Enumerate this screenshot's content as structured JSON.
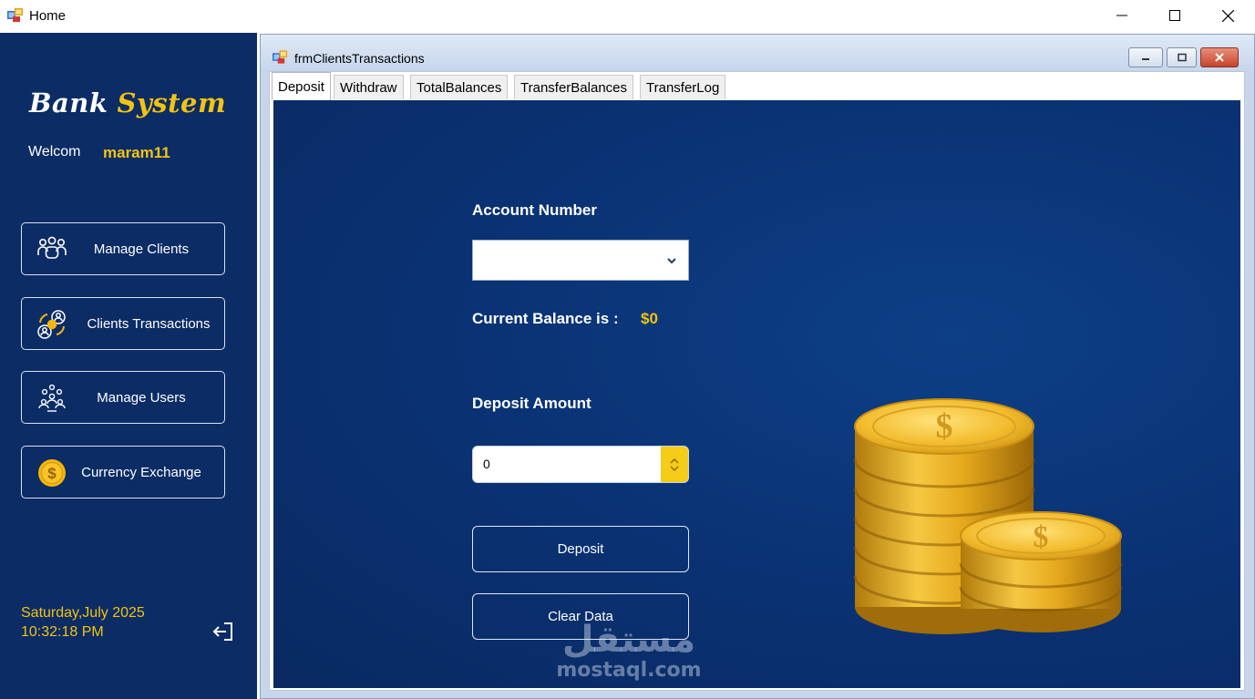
{
  "window": {
    "title": "Home"
  },
  "sidebar": {
    "brand_primary": "Bank",
    "brand_accent": "System",
    "welcome_label": "Welcom",
    "username": "maram11",
    "nav": [
      {
        "label": "Manage Clients",
        "icon": "users-group-icon"
      },
      {
        "label": "Clients Transactions",
        "icon": "money-transfer-icon"
      },
      {
        "label": "Manage Users",
        "icon": "user-network-icon"
      },
      {
        "label": "Currency Exchange",
        "icon": "dollar-coin-icon"
      }
    ],
    "date": "Saturday,July 2025",
    "time": "10:32:18 PM"
  },
  "child_window": {
    "title": "frmClientsTransactions",
    "tabs": [
      {
        "label": "Deposit",
        "active": true
      },
      {
        "label": "Withdraw",
        "active": false
      },
      {
        "label": "TotalBalances",
        "active": false
      },
      {
        "label": "TransferBalances",
        "active": false
      },
      {
        "label": "TransferLog",
        "active": false
      }
    ]
  },
  "deposit": {
    "account_label": "Account Number",
    "account_value": "",
    "balance_label": "Current Balance is :",
    "balance_value": "$0",
    "amount_label": "Deposit Amount",
    "amount_value": "0",
    "deposit_button": "Deposit",
    "clear_button": "Clear Data"
  },
  "watermark": {
    "arabic": "مستقل",
    "latin": "mostaql.com"
  },
  "colors": {
    "sidebar_bg": "#0c2c66",
    "accent": "#f2c311",
    "panel_bg": "#0a3172"
  }
}
